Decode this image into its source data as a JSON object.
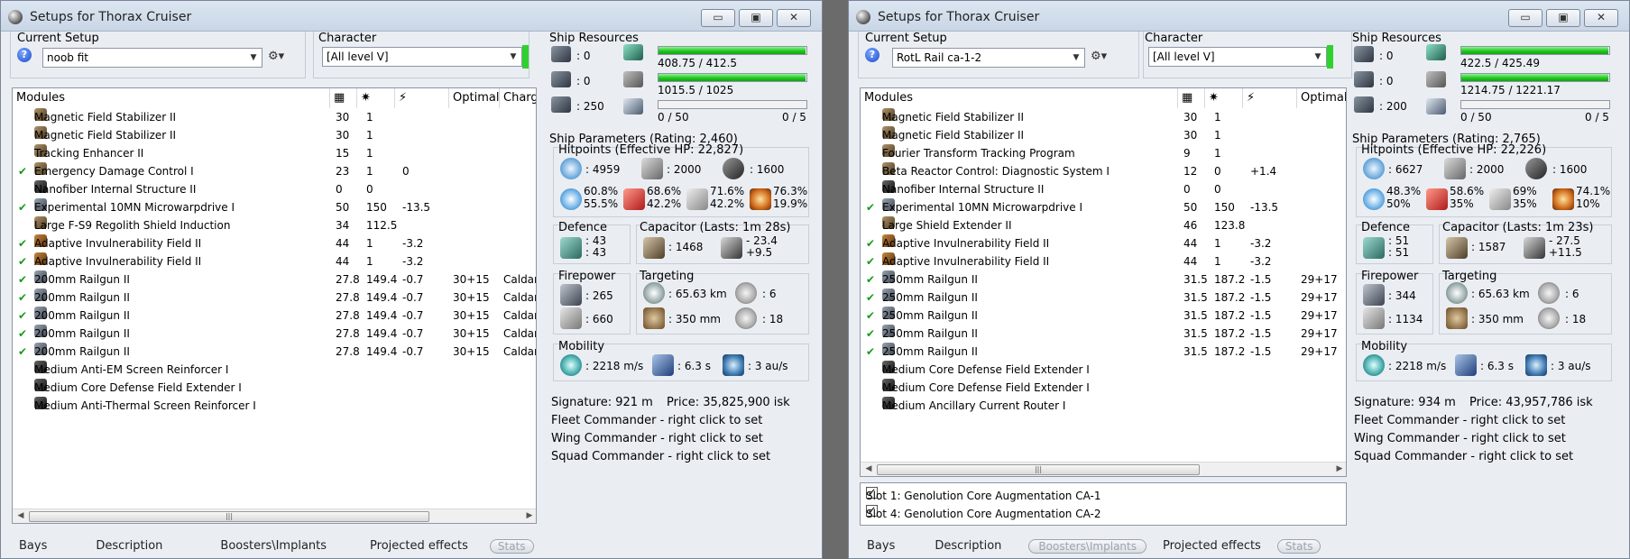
{
  "divider_color": "#6b6b6b",
  "accent_green": "#2fd12f",
  "left": {
    "title": "Setups for Thorax Cruiser",
    "current_setup_label": "Current Setup",
    "setup_value": "noob fit",
    "character_label": "Character",
    "character_value": "[All level V]",
    "columns": [
      "Modules",
      "Optimal",
      "Charge"
    ],
    "modules": [
      {
        "active": "",
        "icon": "mod",
        "name": "Magnetic Field Stabilizer II",
        "cpu": "30",
        "pg": "1",
        "cap": "",
        "opt": "",
        "charge": ""
      },
      {
        "active": "",
        "icon": "mod",
        "name": "Magnetic Field Stabilizer II",
        "cpu": "30",
        "pg": "1",
        "cap": "",
        "opt": "",
        "charge": ""
      },
      {
        "active": "",
        "icon": "mod",
        "name": "Tracking Enhancer II",
        "cpu": "15",
        "pg": "1",
        "cap": "",
        "opt": "",
        "charge": ""
      },
      {
        "active": "✔",
        "icon": "mod",
        "name": "Emergency Damage Control I",
        "cpu": "23",
        "pg": "1",
        "cap": "0",
        "opt": "",
        "charge": ""
      },
      {
        "active": "",
        "icon": "rig",
        "name": "Nanofiber Internal Structure II",
        "cpu": "0",
        "pg": "0",
        "cap": "",
        "opt": "",
        "charge": ""
      },
      {
        "active": "✔",
        "icon": "gun",
        "name": "Experimental 10MN Microwarpdrive I",
        "cpu": "50",
        "pg": "150",
        "cap": "-13.5",
        "opt": "",
        "charge": ""
      },
      {
        "active": "",
        "icon": "mod",
        "name": "Large F-S9 Regolith Shield Induction",
        "cpu": "34",
        "pg": "112.5",
        "cap": "",
        "opt": "",
        "charge": ""
      },
      {
        "active": "✔",
        "icon": "shield",
        "name": "Adaptive Invulnerability Field II",
        "cpu": "44",
        "pg": "1",
        "cap": "-3.2",
        "opt": "",
        "charge": ""
      },
      {
        "active": "✔",
        "icon": "shield",
        "name": "Adaptive Invulnerability Field II",
        "cpu": "44",
        "pg": "1",
        "cap": "-3.2",
        "opt": "",
        "charge": ""
      },
      {
        "active": "✔",
        "icon": "gun",
        "name": "200mm Railgun II",
        "cpu": "27.8",
        "pg": "149.4",
        "cap": "-0.7",
        "opt": "30+15",
        "charge": "Caldari"
      },
      {
        "active": "✔",
        "icon": "gun",
        "name": "200mm Railgun II",
        "cpu": "27.8",
        "pg": "149.4",
        "cap": "-0.7",
        "opt": "30+15",
        "charge": "Caldari"
      },
      {
        "active": "✔",
        "icon": "gun",
        "name": "200mm Railgun II",
        "cpu": "27.8",
        "pg": "149.4",
        "cap": "-0.7",
        "opt": "30+15",
        "charge": "Caldari"
      },
      {
        "active": "✔",
        "icon": "gun",
        "name": "200mm Railgun II",
        "cpu": "27.8",
        "pg": "149.4",
        "cap": "-0.7",
        "opt": "30+15",
        "charge": "Caldari"
      },
      {
        "active": "✔",
        "icon": "gun",
        "name": "200mm Railgun II",
        "cpu": "27.8",
        "pg": "149.4",
        "cap": "-0.7",
        "opt": "30+15",
        "charge": "Caldari"
      },
      {
        "active": "",
        "icon": "rig",
        "name": "Medium Anti-EM Screen Reinforcer I",
        "cpu": "",
        "pg": "",
        "cap": "",
        "opt": "",
        "charge": ""
      },
      {
        "active": "",
        "icon": "rig",
        "name": "Medium Core Defense Field Extender I",
        "cpu": "",
        "pg": "",
        "cap": "",
        "opt": "",
        "charge": ""
      },
      {
        "active": "",
        "icon": "rig",
        "name": "Medium Anti-Thermal Screen Reinforcer I",
        "cpu": "",
        "pg": "",
        "cap": "",
        "opt": "",
        "charge": ""
      }
    ],
    "tabs": [
      "Bays",
      "Description",
      "Boosters\\Implants",
      "Projected effects",
      "Stats"
    ],
    "resources": {
      "title": "Ship Resources",
      "turret": ": 0",
      "launcher": ": 0",
      "drone_bw": ": 250",
      "cpu_text": "408.75 / 412.5",
      "cpu_frac": 0.991,
      "pg_text": "1015.5 / 1025",
      "pg_frac": 0.991,
      "drone_text": "0 / 50",
      "drone_frac": 0,
      "calib_text": "0 / 5"
    },
    "params": {
      "title": "Ship Parameters (Rating: 2,460)",
      "hp_title": "Hitpoints (Effective HP: 22,827)",
      "shield_hp": ": 4959",
      "armor_hp": ": 2000",
      "hull_hp": ": 1600",
      "em": "60.8%\n55.5%",
      "therm": "68.6%\n42.2%",
      "kin": "71.6%\n42.2%",
      "exp": "76.3%\n19.9%",
      "defence_title": "Defence",
      "defence": ": 43\n: 43",
      "capacitor_title": "Capacitor (Lasts: 1m 28s)",
      "cap_amount": ": 1468",
      "cap_delta": "- 23.4\n+9.5",
      "firepower_title": "Firepower",
      "dps": ": 265",
      "volley": ": 660",
      "targeting_title": "Targeting",
      "range": ": 65.63 km",
      "targets": ": 6",
      "scanres": ": 350 mm",
      "sensor": ": 18",
      "mobility_title": "Mobility",
      "speed": ": 2218 m/s",
      "align": ": 6.3 s",
      "warp": ": 3 au/s"
    },
    "signature": "Signature: 921 m",
    "price": "Price: 35,825,900 isk",
    "fleet": "Fleet Commander - right click to set",
    "wing": "Wing Commander - right click to set",
    "squad": "Squad Commander - right click to set"
  },
  "right": {
    "title": "Setups for Thorax Cruiser",
    "current_setup_label": "Current Setup",
    "setup_value": "RotL Rail ca-1-2",
    "character_label": "Character",
    "character_value": "[All level V]",
    "columns": [
      "Modules",
      "Optimal"
    ],
    "modules": [
      {
        "active": "",
        "icon": "mod",
        "name": "Magnetic Field Stabilizer II",
        "cpu": "30",
        "pg": "1",
        "cap": "",
        "opt": ""
      },
      {
        "active": "",
        "icon": "mod",
        "name": "Magnetic Field Stabilizer II",
        "cpu": "30",
        "pg": "1",
        "cap": "",
        "opt": ""
      },
      {
        "active": "",
        "icon": "mod",
        "name": "Fourier Transform Tracking Program",
        "cpu": "9",
        "pg": "1",
        "cap": "",
        "opt": ""
      },
      {
        "active": "",
        "icon": "mod",
        "name": "Beta Reactor Control: Diagnostic System I",
        "cpu": "12",
        "pg": "0",
        "cap": "+1.4",
        "opt": ""
      },
      {
        "active": "",
        "icon": "rig",
        "name": "Nanofiber Internal Structure II",
        "cpu": "0",
        "pg": "0",
        "cap": "",
        "opt": ""
      },
      {
        "active": "✔",
        "icon": "gun",
        "name": "Experimental 10MN Microwarpdrive I",
        "cpu": "50",
        "pg": "150",
        "cap": "-13.5",
        "opt": ""
      },
      {
        "active": "",
        "icon": "mod",
        "name": "Large Shield Extender II",
        "cpu": "46",
        "pg": "123.8",
        "cap": "",
        "opt": ""
      },
      {
        "active": "✔",
        "icon": "shield",
        "name": "Adaptive Invulnerability Field II",
        "cpu": "44",
        "pg": "1",
        "cap": "-3.2",
        "opt": ""
      },
      {
        "active": "✔",
        "icon": "shield",
        "name": "Adaptive Invulnerability Field II",
        "cpu": "44",
        "pg": "1",
        "cap": "-3.2",
        "opt": ""
      },
      {
        "active": "✔",
        "icon": "gun",
        "name": "250mm Railgun II",
        "cpu": "31.5",
        "pg": "187.2",
        "cap": "-1.5",
        "opt": "29+17"
      },
      {
        "active": "✔",
        "icon": "gun",
        "name": "250mm Railgun II",
        "cpu": "31.5",
        "pg": "187.2",
        "cap": "-1.5",
        "opt": "29+17"
      },
      {
        "active": "✔",
        "icon": "gun",
        "name": "250mm Railgun II",
        "cpu": "31.5",
        "pg": "187.2",
        "cap": "-1.5",
        "opt": "29+17"
      },
      {
        "active": "✔",
        "icon": "gun",
        "name": "250mm Railgun II",
        "cpu": "31.5",
        "pg": "187.2",
        "cap": "-1.5",
        "opt": "29+17"
      },
      {
        "active": "✔",
        "icon": "gun",
        "name": "250mm Railgun II",
        "cpu": "31.5",
        "pg": "187.2",
        "cap": "-1.5",
        "opt": "29+17"
      },
      {
        "active": "",
        "icon": "rig",
        "name": "Medium Core Defense Field Extender I",
        "cpu": "",
        "pg": "",
        "cap": "",
        "opt": ""
      },
      {
        "active": "",
        "icon": "rig",
        "name": "Medium Core Defense Field Extender I",
        "cpu": "",
        "pg": "",
        "cap": "",
        "opt": ""
      },
      {
        "active": "",
        "icon": "rig",
        "name": "Medium Ancillary Current Router I",
        "cpu": "",
        "pg": "",
        "cap": "",
        "opt": ""
      }
    ],
    "implants": [
      "Slot 1: Genolution Core Augmentation CA-1",
      "Slot 4: Genolution Core Augmentation CA-2"
    ],
    "tabs": [
      "Bays",
      "Description",
      "Boosters\\Implants",
      "Projected effects",
      "Stats"
    ],
    "resources": {
      "title": "Ship Resources",
      "turret": ": 0",
      "launcher": ": 0",
      "drone_bw": ": 200",
      "cpu_text": "422.5 / 425.49",
      "cpu_frac": 0.993,
      "pg_text": "1214.75 / 1221.17",
      "pg_frac": 0.995,
      "drone_text": "0 / 50",
      "drone_frac": 0,
      "calib_text": "0 / 5"
    },
    "params": {
      "title": "Ship Parameters (Rating: 2,765)",
      "hp_title": "Hitpoints (Effective HP: 22,226)",
      "shield_hp": ": 6627",
      "armor_hp": ": 2000",
      "hull_hp": ": 1600",
      "em": "48.3%\n50%",
      "therm": "58.6%\n35%",
      "kin": "69%\n35%",
      "exp": "74.1%\n10%",
      "defence_title": "Defence",
      "defence": ": 51\n: 51",
      "capacitor_title": "Capacitor (Lasts: 1m 23s)",
      "cap_amount": ": 1587",
      "cap_delta": "- 27.5\n+11.5",
      "firepower_title": "Firepower",
      "dps": ": 344",
      "volley": ": 1134",
      "targeting_title": "Targeting",
      "range": ": 65.63 km",
      "targets": ": 6",
      "scanres": ": 350 mm",
      "sensor": ": 18",
      "mobility_title": "Mobility",
      "speed": ": 2218 m/s",
      "align": ": 6.3 s",
      "warp": ": 3 au/s"
    },
    "signature": "Signature: 934 m",
    "price": "Price: 43,957,786 isk",
    "fleet": "Fleet Commander - right click to set",
    "wing": "Wing Commander - right click to set",
    "squad": "Squad Commander - right click to set"
  }
}
